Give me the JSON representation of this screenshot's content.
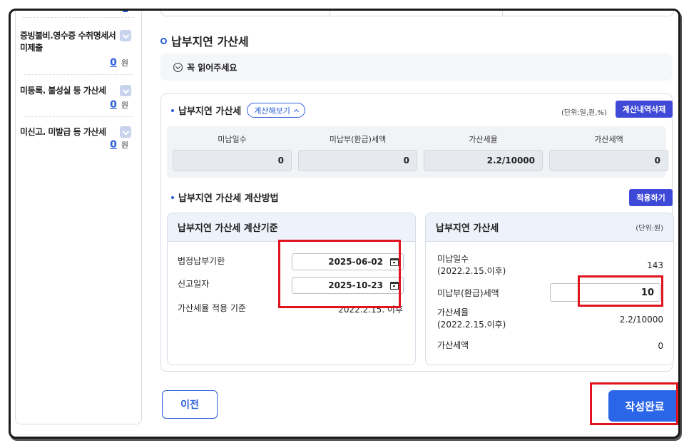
{
  "sidebar": {
    "items": [
      {
        "name": "증빙불비.영수증 수취명세서 미제출",
        "amount": "0",
        "unit": "원"
      },
      {
        "name": "미등록. 불성실 등 가산세",
        "amount": "0",
        "unit": "원"
      },
      {
        "name": "미신고. 미발급 등 가산세",
        "amount": "0",
        "unit": "원"
      }
    ]
  },
  "section": {
    "title": "납부지연 가산세"
  },
  "notice": {
    "label": "꼭 읽어주세요"
  },
  "summary": {
    "title": "납부지연 가산세",
    "toggle_label": "계산해보기",
    "unit_label": "(단위:일,원,%)",
    "delete_button": "계산내역삭제",
    "headers": [
      "미납일수",
      "미납부(환급)세액",
      "가산세율",
      "가산세액"
    ],
    "values": [
      "0",
      "0",
      "2.2/10000",
      "0"
    ]
  },
  "method": {
    "title": "납부지연 가산세 계산방법",
    "apply_button": "적용하기"
  },
  "criteria": {
    "title": "납부지연 가산세 계산기준",
    "rows": [
      {
        "label": "법정납부기한",
        "value": "2025-06-02"
      },
      {
        "label": "신고일자",
        "value": "2025-10-23"
      },
      {
        "label": "가산세율 적용 기준",
        "value": "2022.2.15. 이후"
      }
    ]
  },
  "result": {
    "title": "납부지연 가산세",
    "unit_label": "(단위:원)",
    "rows": [
      {
        "label": "미납일수\n(2022.2.15.이후)",
        "value": "143"
      },
      {
        "label": "미납부(환급)세액",
        "value": "10"
      },
      {
        "label": "가산세율\n(2022.2.15.이후)",
        "value": "2.2/10000"
      },
      {
        "label": "가산세액",
        "value": "0"
      }
    ]
  },
  "footer": {
    "prev_button": "이전",
    "complete_button": "작성완료"
  },
  "colors": {
    "accent": "#2b5fd9",
    "highlight": "#e0141f",
    "primary_button": "#2b66e8"
  }
}
